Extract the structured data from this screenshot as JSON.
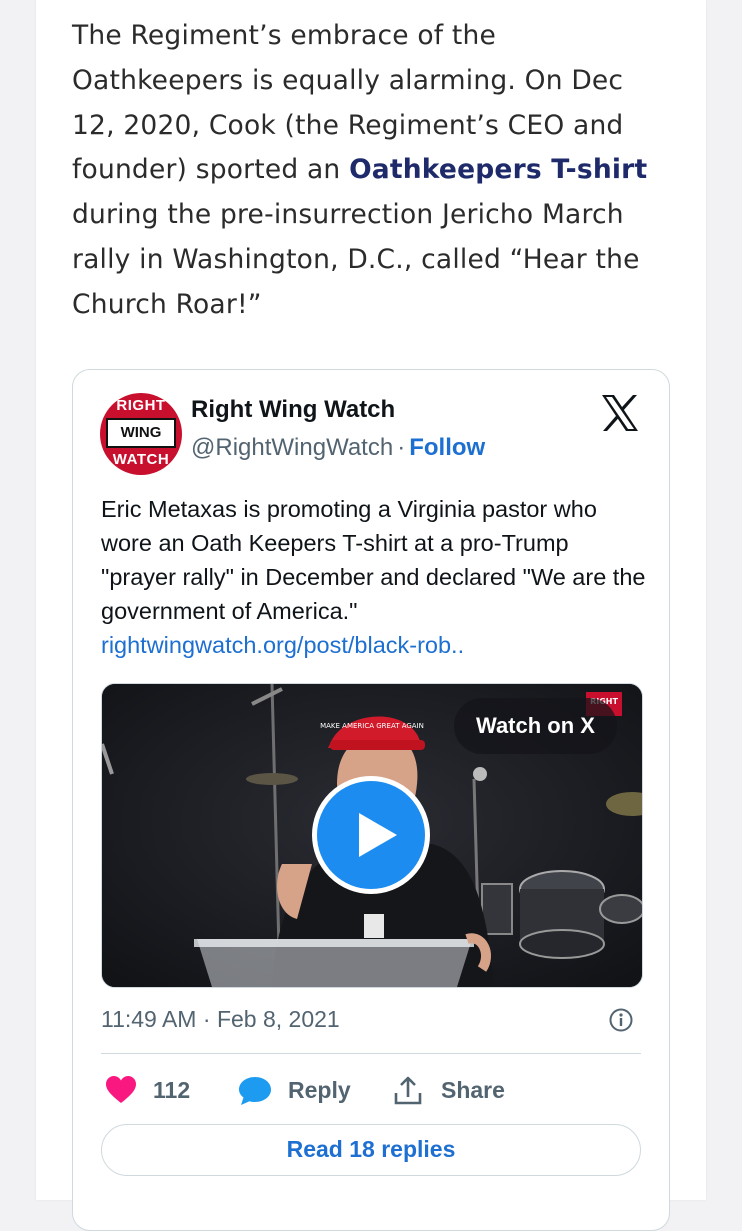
{
  "article": {
    "text_before": "The Regiment’s embrace of the Oathkeepers is equally alarming. On Dec 12, 2020, Cook (the Regiment’s CEO and founder) sported an ",
    "link_text": "Oathkeepers T-shirt",
    "text_after": " during the pre-insurrection Jericho March rally in Washington, D.C., called “Hear the Church Roar!”"
  },
  "tweet": {
    "avatar": {
      "top": "RIGHT",
      "middle": "WING",
      "bottom": "WATCH"
    },
    "author_name": "Right Wing Watch",
    "handle": "@RightWingWatch",
    "separator": "·",
    "follow_label": "Follow",
    "text": "Eric Metaxas is promoting a Virginia pastor who wore an Oath Keepers T-shirt at a pro-Trump \"prayer rally\" in December and declared \"We are the government of America.\"",
    "link": "rightwingwatch.org/post/black-rob..",
    "media": {
      "watch_label": "Watch on X",
      "watermark": "RIGHT",
      "hat_text": "MAKE AMERICA GREAT AGAIN"
    },
    "time": "11:49 AM",
    "date_separator": "·",
    "date": "Feb 8, 2021",
    "likes": "112",
    "reply_label": "Reply",
    "share_label": "Share",
    "read_replies_label": "Read 18 replies"
  },
  "colors": {
    "link_blue": "#1d6fd1",
    "article_link": "#1f2a6b",
    "heart": "#f91880",
    "reply_bubble": "#1d9bf0",
    "avatar_red": "#c8102e"
  },
  "icons": [
    "x-logo-icon",
    "play-icon",
    "info-icon",
    "heart-icon",
    "reply-bubble-icon",
    "share-icon"
  ]
}
